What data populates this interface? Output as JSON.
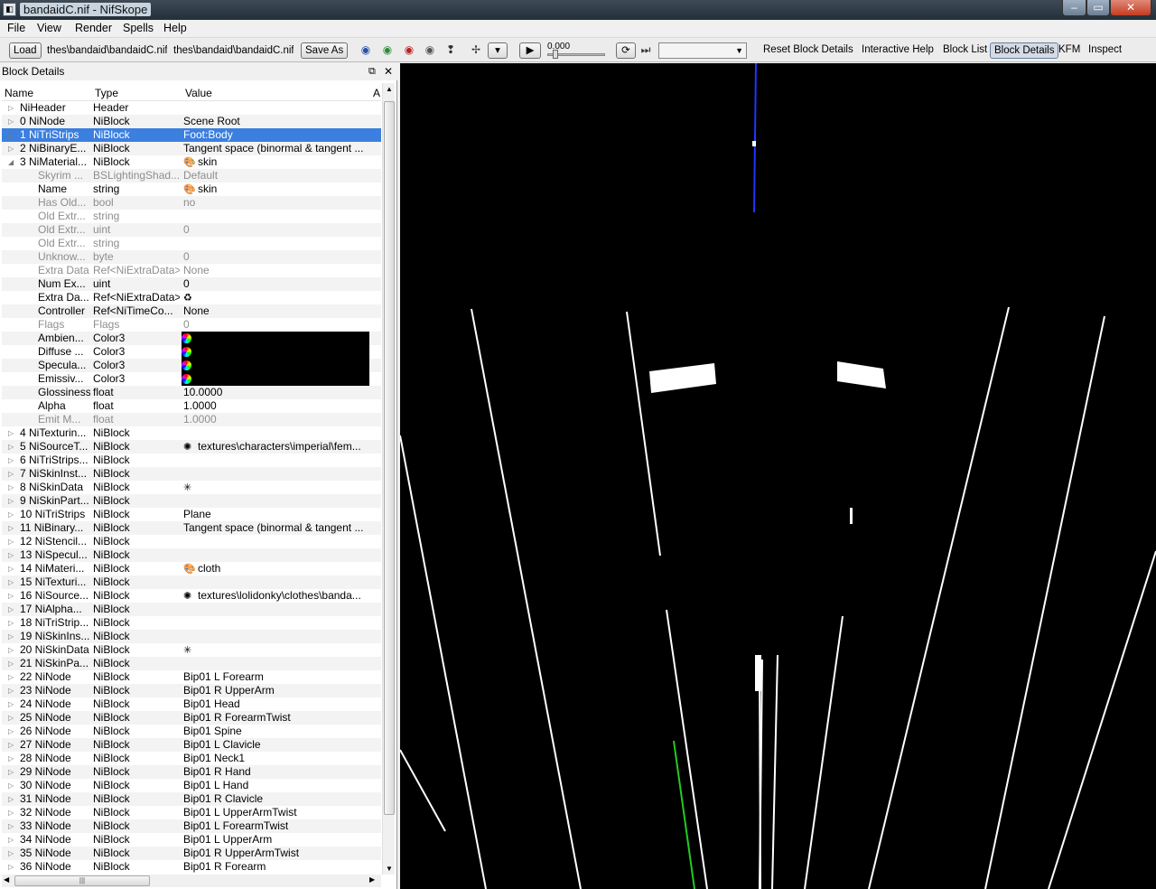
{
  "window": {
    "title": "bandaidC.nif - NifSkope",
    "controls": [
      "–",
      "▭",
      "✕"
    ]
  },
  "menu": [
    "File",
    "View",
    "Render",
    "Spells",
    "Help"
  ],
  "toolbar": {
    "load_label": "Load",
    "load_path": "thes\\bandaid\\bandaidC.nif",
    "save_path": "thes\\bandaid\\bandaidC.nif",
    "saveas_label": "Save As",
    "time_value": "0.000",
    "links": [
      "Reset Block Details",
      "Interactive Help",
      "Block List",
      "Block Details",
      "KFM",
      "Inspect"
    ]
  },
  "dock": {
    "title": "Block Details"
  },
  "tree": {
    "headers": {
      "name": "Name",
      "type": "Type",
      "value": "Value",
      "extra": "A"
    },
    "rows": [
      {
        "n": "NiHeader",
        "t": "Header",
        "v": "",
        "exp": "▷"
      },
      {
        "n": "0 NiNode",
        "t": "NiBlock",
        "v": "Scene Root",
        "exp": "▷"
      },
      {
        "n": "1 NiTriStrips",
        "t": "NiBlock",
        "v": "Foot:Body",
        "exp": "▷",
        "sel": true
      },
      {
        "n": "2 NiBinaryE...",
        "t": "NiBlock",
        "v": "Tangent space (binormal & tangent ...",
        "exp": "▷"
      },
      {
        "n": "3 NiMaterial...",
        "t": "NiBlock",
        "v": "skin",
        "exp": "◢",
        "icon": "🎨"
      },
      {
        "n": "Skyrim ...",
        "t": "BSLightingShad...",
        "v": "Default",
        "child": true,
        "dim": true
      },
      {
        "n": "Name",
        "t": "string",
        "v": "skin",
        "child": true,
        "icon": "🎨"
      },
      {
        "n": "Has Old...",
        "t": "bool",
        "v": "no",
        "child": true,
        "dim": true
      },
      {
        "n": "Old Extr...",
        "t": "string",
        "v": "",
        "child": true,
        "dim": true
      },
      {
        "n": "Old Extr...",
        "t": "uint",
        "v": "0",
        "child": true,
        "dim": true
      },
      {
        "n": "Old Extr...",
        "t": "string",
        "v": "",
        "child": true,
        "dim": true
      },
      {
        "n": "Unknow...",
        "t": "byte",
        "v": "0",
        "child": true,
        "dim": true
      },
      {
        "n": "Extra Data",
        "t": "Ref<NiExtraData>",
        "v": "None",
        "child": true,
        "dim": true
      },
      {
        "n": "Num Ex...",
        "t": "uint",
        "v": "0",
        "child": true
      },
      {
        "n": "Extra Da...",
        "t": "Ref<NiExtraData>",
        "v": "",
        "child": true,
        "icon": "♻"
      },
      {
        "n": "Controller",
        "t": "Ref<NiTimeCo...",
        "v": "None",
        "child": true
      },
      {
        "n": "Flags",
        "t": "Flags",
        "v": "0",
        "child": true,
        "dim": true
      },
      {
        "n": "Ambien...",
        "t": "Color3",
        "v": "",
        "child": true,
        "color": true
      },
      {
        "n": "Diffuse ...",
        "t": "Color3",
        "v": "",
        "child": true,
        "color": true
      },
      {
        "n": "Specula...",
        "t": "Color3",
        "v": "",
        "child": true,
        "color": true
      },
      {
        "n": "Emissiv...",
        "t": "Color3",
        "v": "",
        "child": true,
        "color": true
      },
      {
        "n": "Glossiness",
        "t": "float",
        "v": "10.0000",
        "child": true
      },
      {
        "n": "Alpha",
        "t": "float",
        "v": "1.0000",
        "child": true
      },
      {
        "n": "Emit M...",
        "t": "float",
        "v": "1.0000",
        "child": true,
        "dim": true
      },
      {
        "n": "4 NiTexturin...",
        "t": "NiBlock",
        "v": "",
        "exp": "▷"
      },
      {
        "n": "5 NiSourceT...",
        "t": "NiBlock",
        "v": "textures\\characters\\imperial\\fem...",
        "exp": "▷",
        "icon": "✺"
      },
      {
        "n": "6 NiTriStrips...",
        "t": "NiBlock",
        "v": "",
        "exp": "▷"
      },
      {
        "n": "7 NiSkinInst...",
        "t": "NiBlock",
        "v": "",
        "exp": "▷"
      },
      {
        "n": "8 NiSkinData",
        "t": "NiBlock",
        "v": "",
        "exp": "▷",
        "icon": "✳"
      },
      {
        "n": "9 NiSkinPart...",
        "t": "NiBlock",
        "v": "",
        "exp": "▷"
      },
      {
        "n": "10 NiTriStrips",
        "t": "NiBlock",
        "v": "Plane",
        "exp": "▷"
      },
      {
        "n": "11 NiBinary...",
        "t": "NiBlock",
        "v": "Tangent space (binormal & tangent ...",
        "exp": "▷"
      },
      {
        "n": "12 NiStencil...",
        "t": "NiBlock",
        "v": "",
        "exp": "▷"
      },
      {
        "n": "13 NiSpecul...",
        "t": "NiBlock",
        "v": "",
        "exp": "▷"
      },
      {
        "n": "14 NiMateri...",
        "t": "NiBlock",
        "v": "cloth",
        "exp": "▷",
        "icon": "🎨"
      },
      {
        "n": "15 NiTexturi...",
        "t": "NiBlock",
        "v": "",
        "exp": "▷"
      },
      {
        "n": "16 NiSource...",
        "t": "NiBlock",
        "v": "textures\\lolidonky\\clothes\\banda...",
        "exp": "▷",
        "icon": "✺"
      },
      {
        "n": "17 NiAlpha...",
        "t": "NiBlock",
        "v": "",
        "exp": "▷"
      },
      {
        "n": "18 NiTriStrip...",
        "t": "NiBlock",
        "v": "",
        "exp": "▷"
      },
      {
        "n": "19 NiSkinIns...",
        "t": "NiBlock",
        "v": "",
        "exp": "▷"
      },
      {
        "n": "20 NiSkinData",
        "t": "NiBlock",
        "v": "",
        "exp": "▷",
        "icon": "✳"
      },
      {
        "n": "21 NiSkinPa...",
        "t": "NiBlock",
        "v": "",
        "exp": "▷"
      },
      {
        "n": "22 NiNode",
        "t": "NiBlock",
        "v": "Bip01 L Forearm",
        "exp": "▷"
      },
      {
        "n": "23 NiNode",
        "t": "NiBlock",
        "v": "Bip01 R UpperArm",
        "exp": "▷"
      },
      {
        "n": "24 NiNode",
        "t": "NiBlock",
        "v": "Bip01 Head",
        "exp": "▷"
      },
      {
        "n": "25 NiNode",
        "t": "NiBlock",
        "v": "Bip01 R ForearmTwist",
        "exp": "▷"
      },
      {
        "n": "26 NiNode",
        "t": "NiBlock",
        "v": "Bip01 Spine",
        "exp": "▷"
      },
      {
        "n": "27 NiNode",
        "t": "NiBlock",
        "v": "Bip01 L Clavicle",
        "exp": "▷"
      },
      {
        "n": "28 NiNode",
        "t": "NiBlock",
        "v": "Bip01 Neck1",
        "exp": "▷"
      },
      {
        "n": "29 NiNode",
        "t": "NiBlock",
        "v": "Bip01 R Hand",
        "exp": "▷"
      },
      {
        "n": "30 NiNode",
        "t": "NiBlock",
        "v": "Bip01 L Hand",
        "exp": "▷"
      },
      {
        "n": "31 NiNode",
        "t": "NiBlock",
        "v": "Bip01 R Clavicle",
        "exp": "▷"
      },
      {
        "n": "32 NiNode",
        "t": "NiBlock",
        "v": "Bip01 L UpperArmTwist",
        "exp": "▷"
      },
      {
        "n": "33 NiNode",
        "t": "NiBlock",
        "v": "Bip01 L ForearmTwist",
        "exp": "▷"
      },
      {
        "n": "34 NiNode",
        "t": "NiBlock",
        "v": "Bip01 L UpperArm",
        "exp": "▷"
      },
      {
        "n": "35 NiNode",
        "t": "NiBlock",
        "v": "Bip01 R UpperArmTwist",
        "exp": "▷"
      },
      {
        "n": "36 NiNode",
        "t": "NiBlock",
        "v": "Bip01 R Forearm",
        "exp": "▷"
      }
    ]
  }
}
